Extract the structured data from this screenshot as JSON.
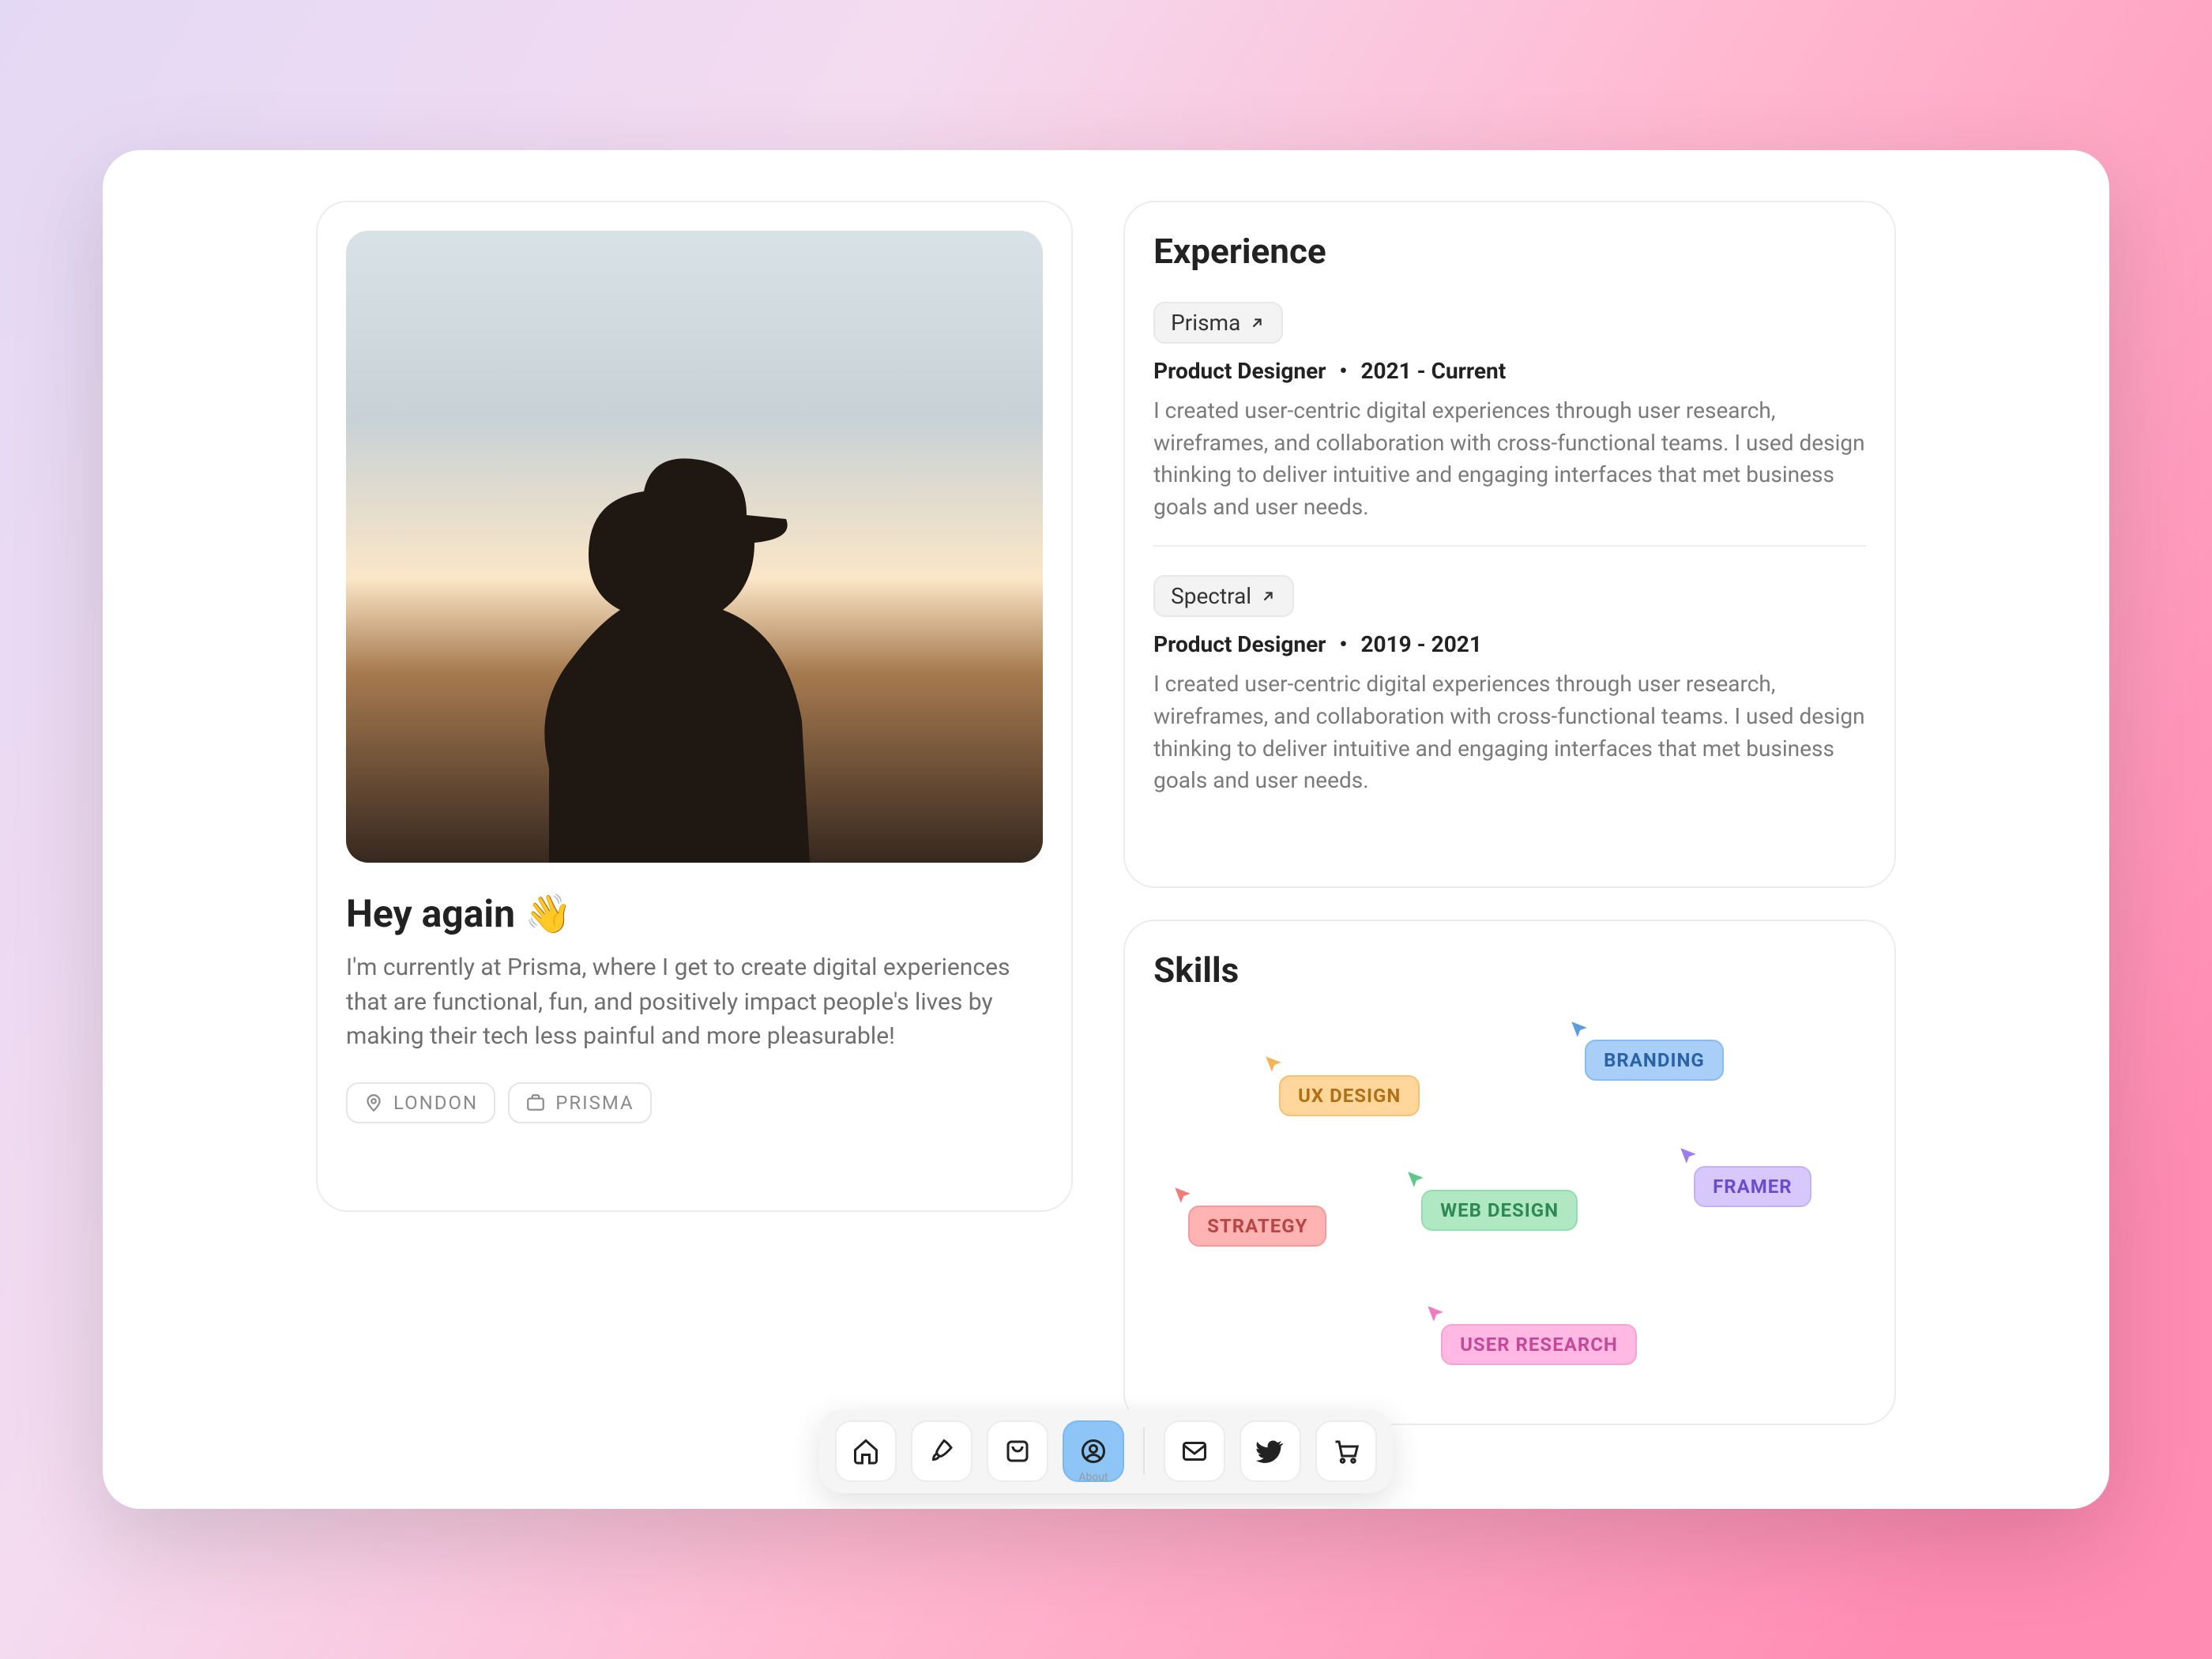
{
  "profile": {
    "greeting": "Hey again 👋",
    "description": "I'm currently at Prisma, where I get to create digital experiences that are functional, fun, and positively impact people's lives by making their tech less painful and more pleasurable!",
    "location": "LONDON",
    "company": "PRISMA"
  },
  "experience": {
    "title": "Experience",
    "items": [
      {
        "company": "Prisma",
        "role": "Product Designer",
        "period": "2021 - Current",
        "description": "I created user-centric digital experiences through user research, wireframes, and collaboration with cross-functional teams. I used design thinking to deliver intuitive and engaging interfaces that met business goals and user needs."
      },
      {
        "company": "Spectral",
        "role": "Product Designer",
        "period": "2019 - 2021",
        "description": "I created user-centric digital experiences through user research, wireframes, and collaboration with cross-functional teams. I used design thinking to deliver intuitive and engaging interfaces that met business goals and user needs."
      }
    ]
  },
  "skills": {
    "title": "Skills",
    "tags": {
      "ux": "UX DESIGN",
      "branding": "BRANDING",
      "strategy": "STRATEGY",
      "web": "WEB DESIGN",
      "framer": "FRAMER",
      "research": "USER RESEARCH"
    }
  },
  "dock": {
    "active_label": "About"
  }
}
